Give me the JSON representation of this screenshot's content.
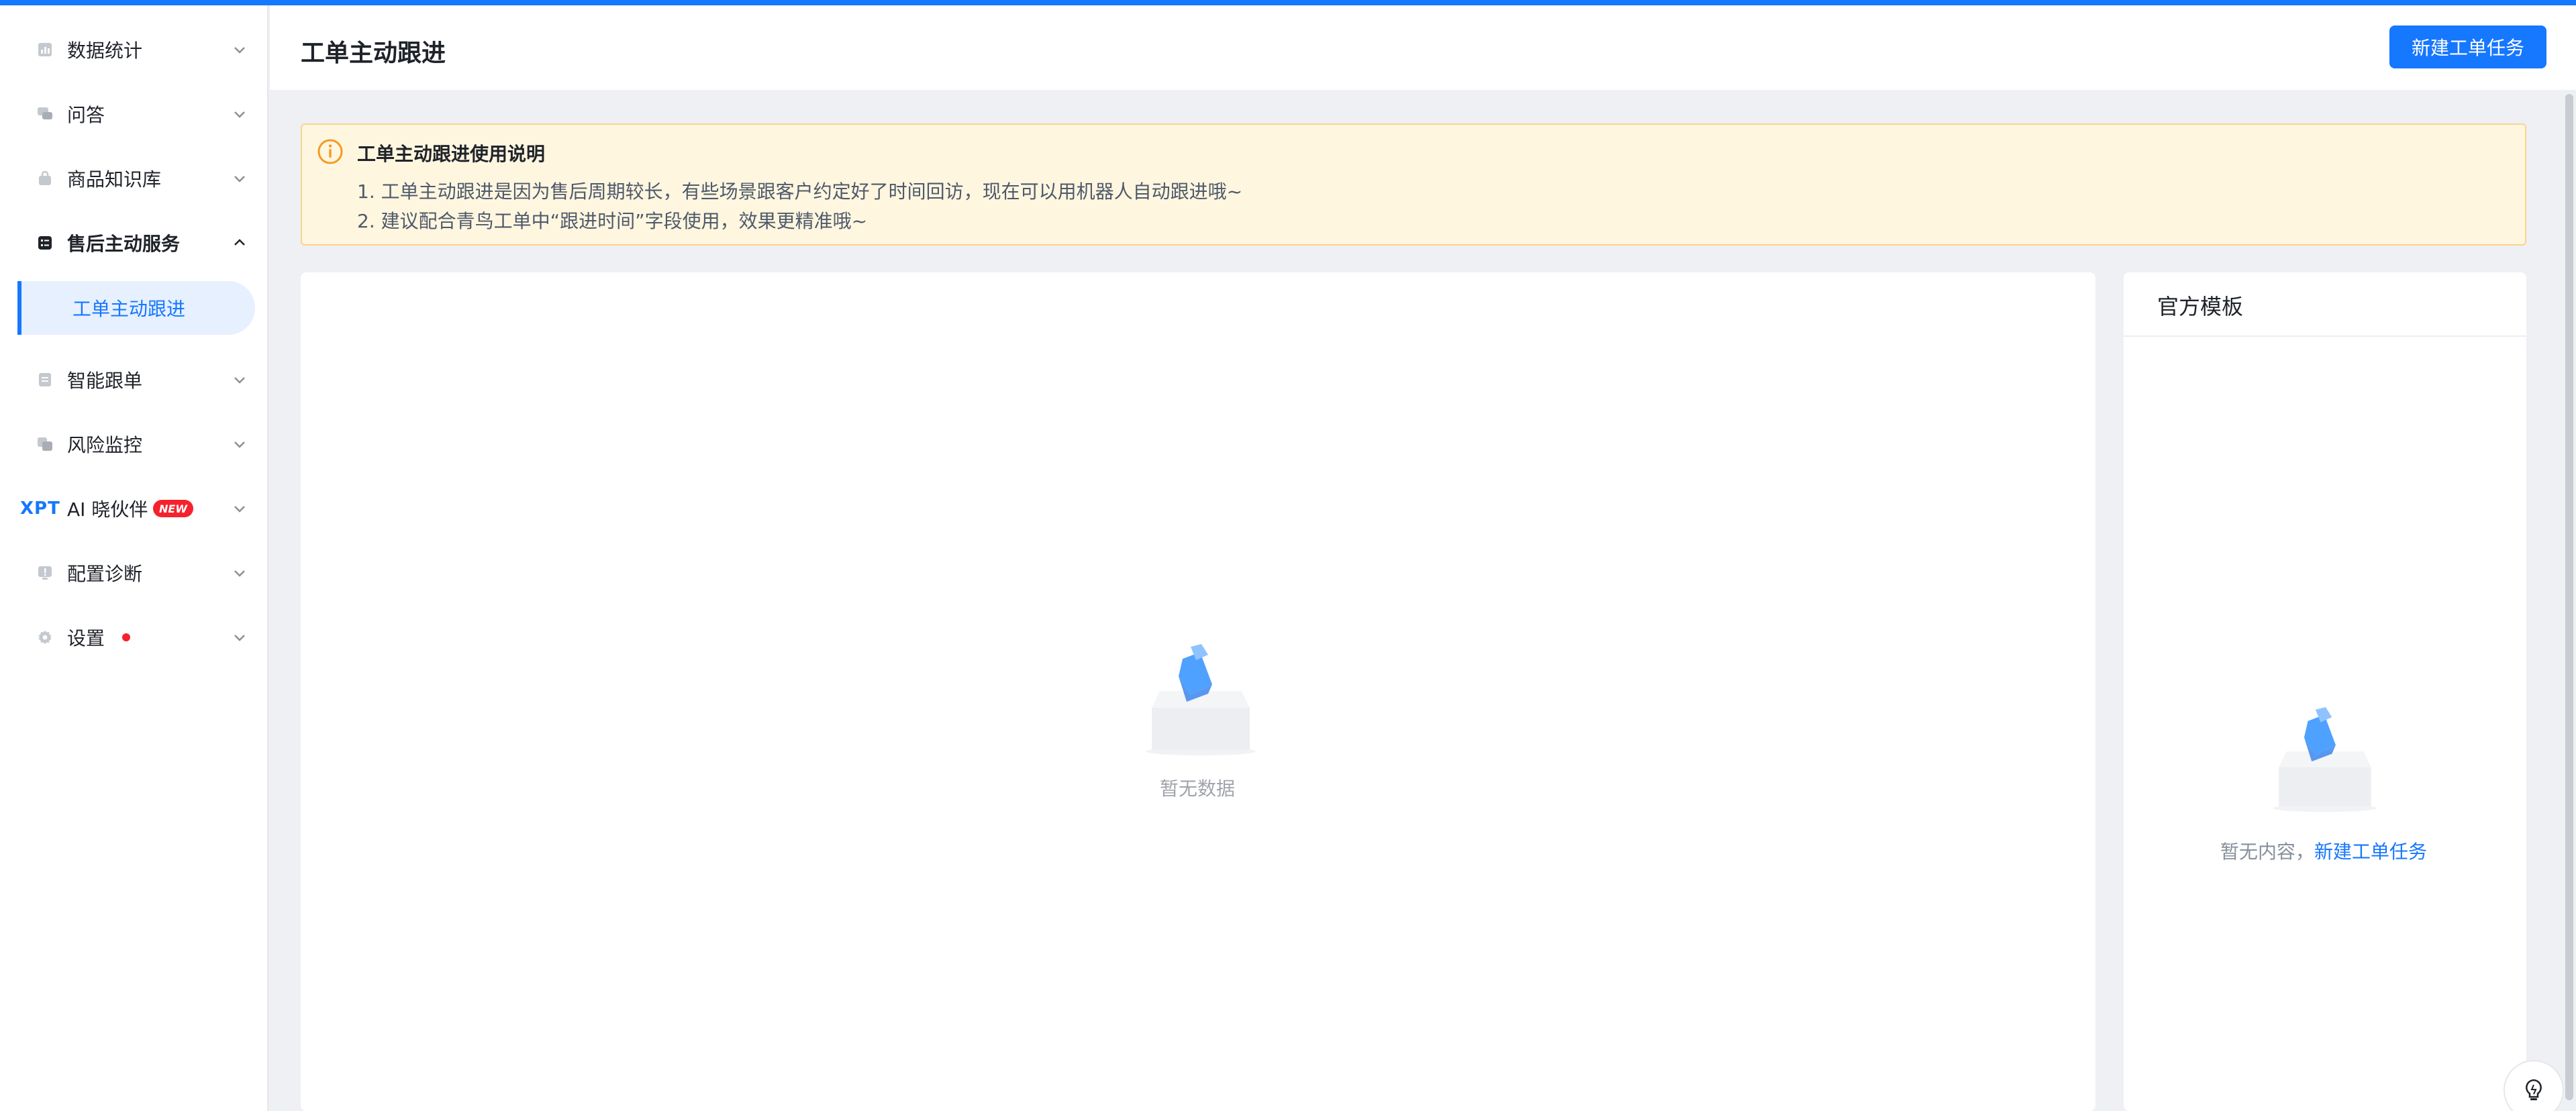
{
  "colors": {
    "accent": "#1677ff",
    "notice_bg": "#fff6e0",
    "badge_red": "#f5222d"
  },
  "sidebar": {
    "items": [
      {
        "label": "数据统计",
        "icon": "chart-icon"
      },
      {
        "label": "问答",
        "icon": "chat-icon"
      },
      {
        "label": "商品知识库",
        "icon": "bag-icon"
      },
      {
        "label": "售后主动服务",
        "icon": "list-icon"
      },
      {
        "label": "智能跟单",
        "icon": "document-icon"
      },
      {
        "label": "风险监控",
        "icon": "monitor-icon"
      },
      {
        "label": "AI 晓伙伴",
        "icon": "xpt-logo"
      },
      {
        "label": "配置诊断",
        "icon": "alert-icon"
      },
      {
        "label": "设置",
        "icon": "gear-icon"
      }
    ],
    "sub_item": "工单主动跟进",
    "xpt_logo": "XPT",
    "new_badge": "NEW"
  },
  "header": {
    "title": "工单主动跟进",
    "new_task_button": "新建工单任务"
  },
  "notice": {
    "title": "工单主动跟进使用说明",
    "line1": "1. 工单主动跟进是因为售后周期较长，有些场景跟客户约定好了时间回访，现在可以用机器人自动跟进哦~",
    "line2": "2. 建议配合青鸟工单中“跟进时间”字段使用，效果更精准哦~"
  },
  "main": {
    "empty_text": "暂无数据"
  },
  "templates": {
    "title": "官方模板",
    "empty_text": "暂无内容，",
    "empty_link": "新建工单任务"
  }
}
